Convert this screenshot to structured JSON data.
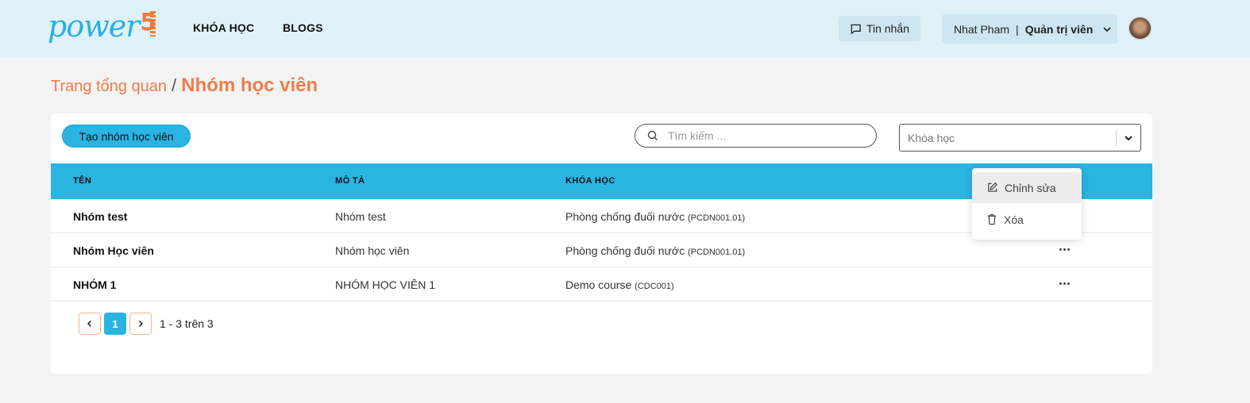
{
  "header": {
    "logo": {
      "text": "power",
      "mark": "5"
    },
    "nav": [
      {
        "label": "KHÓA HỌC"
      },
      {
        "label": "BLOGS"
      }
    ],
    "messages_label": "Tin nhắn",
    "user": {
      "name": "Nhat Pham",
      "separator": "|",
      "role": "Quản trị viên"
    }
  },
  "breadcrumb": {
    "root": "Trang tổng quan",
    "separator": "/",
    "current": "Nhóm học viên"
  },
  "toolbar": {
    "create_label": "Tạo nhóm học viên",
    "search_placeholder": "Tìm kiếm ...",
    "course_filter_placeholder": "Khóa học"
  },
  "table": {
    "headers": {
      "name": "TÊN",
      "description": "MÔ TẢ",
      "course": "KHÓA HỌC"
    },
    "rows": [
      {
        "name": "Nhóm test",
        "description": "Nhóm test",
        "course": "Phòng chống đuối nước",
        "code": "(PCDN001.01)"
      },
      {
        "name": "Nhóm Học viên",
        "description": "Nhóm học viên",
        "course": "Phòng chống đuối nước",
        "code": "(PCDN001.01)"
      },
      {
        "name": "NHÓM 1",
        "description": "NHÓM HỌC VIÊN 1",
        "course": "Demo course",
        "code": "(CDC001)"
      }
    ]
  },
  "pagination": {
    "current_page": "1",
    "info": "1 - 3 trên 3"
  },
  "row_menu": {
    "open_for_row": 1,
    "items": [
      {
        "label": "Chỉnh sửa",
        "icon": "edit-icon"
      },
      {
        "label": "Xóa",
        "icon": "trash-icon"
      }
    ]
  },
  "colors": {
    "accent": "#29b4e2",
    "brand_orange": "#ef7d4a",
    "header_bg": "#dff1f9"
  }
}
